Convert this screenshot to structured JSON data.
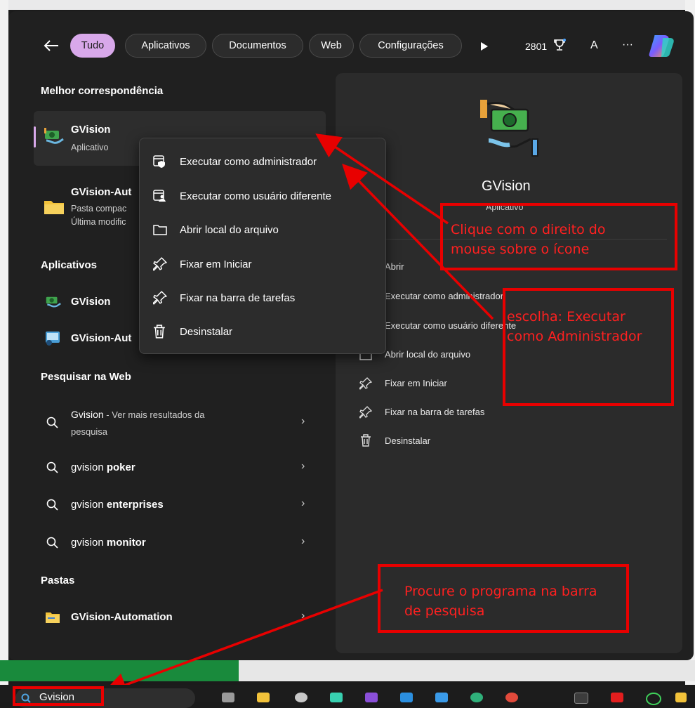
{
  "header": {
    "back_icon": "arrow-left-icon",
    "tabs": [
      "Tudo",
      "Aplicativos",
      "Documentos",
      "Web",
      "Configurações"
    ],
    "points": "2801",
    "avatar": "A",
    "more": "···"
  },
  "sections": {
    "best_match": "Melhor correspondência",
    "apps": "Aplicativos",
    "web": "Pesquisar na Web",
    "folders": "Pastas"
  },
  "best_match": {
    "title": "GVision",
    "subtitle": "Aplicativo"
  },
  "second_result": {
    "title": "GVision-Aut",
    "line1": "Pasta compac",
    "line2": "Última modific"
  },
  "apps": [
    {
      "label": "GVision"
    },
    {
      "label": "GVision-Aut"
    }
  ],
  "web": [
    {
      "term": "Gvision",
      "suffix": " - Ver mais resultados da",
      "line2": "pesquisa"
    },
    {
      "prefix": "gvision ",
      "bold": "poker"
    },
    {
      "prefix": "gvision ",
      "bold": "enterprises"
    },
    {
      "prefix": "gvision ",
      "bold": "monitor"
    }
  ],
  "folders": [
    {
      "label": "GVision-Automation"
    }
  ],
  "context_menu": [
    {
      "label": "Executar como administrador",
      "icon": "shield-window-icon"
    },
    {
      "label": "Executar como usuário diferente",
      "icon": "user-window-icon"
    },
    {
      "label": "Abrir local do arquivo",
      "icon": "folder-icon"
    },
    {
      "label": "Fixar em Iniciar",
      "icon": "pin-icon"
    },
    {
      "label": "Fixar na barra de tarefas",
      "icon": "pin-icon"
    },
    {
      "label": "Desinstalar",
      "icon": "trash-icon"
    }
  ],
  "detail": {
    "title": "GVision",
    "subtitle": "Aplicativo",
    "actions": [
      {
        "label": "Abrir"
      },
      {
        "label": "Executar como administrador"
      },
      {
        "label": "Executar como usuário diferente"
      },
      {
        "label": "Abrir local do arquivo"
      },
      {
        "label": "Fixar em Iniciar"
      },
      {
        "label": "Fixar na barra de tarefas"
      },
      {
        "label": "Desinstalar"
      }
    ]
  },
  "annotations": {
    "a1_line1": "Clique com o direito do",
    "a1_line2": "mouse sobre o ícone",
    "a2_line1": "escolha: Executar",
    "a2_line2": "como Administrador",
    "a3_line1": "Procure o programa na barra",
    "a3_line2": "de pesquisa",
    "color": "#e80000"
  },
  "taskbar": {
    "search_value": "Gvision"
  }
}
